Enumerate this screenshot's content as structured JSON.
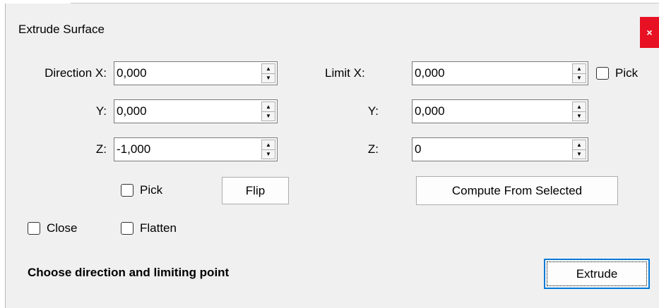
{
  "dialog": {
    "title": "Extrude Surface",
    "close_label": "×"
  },
  "direction": {
    "x_label": "Direction X:",
    "x_value": "0,000",
    "y_label": "Y:",
    "y_value": "0,000",
    "z_label": "Z:",
    "z_value": "-1,000",
    "pick_label": "Pick",
    "flip_label": "Flip"
  },
  "limit": {
    "x_label": "Limit X:",
    "x_value": "0,000",
    "y_label": "Y:",
    "y_value": "0,000",
    "z_label": "Z:",
    "z_value": "0",
    "pick_label": "Pick",
    "compute_label": "Compute From Selected"
  },
  "options": {
    "close_label": "Close",
    "flatten_label": "Flatten"
  },
  "status": "Choose direction and limiting point",
  "extrude_label": "Extrude",
  "spinner_icons": {
    "up": "▲",
    "down": "▼"
  }
}
